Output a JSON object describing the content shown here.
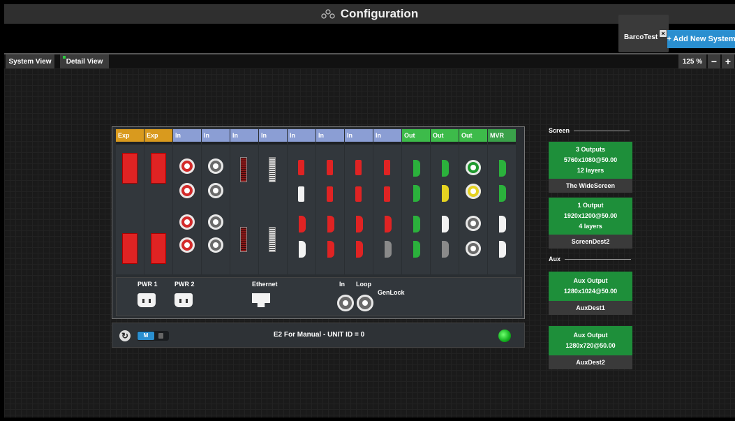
{
  "window": {
    "title": "Configuration",
    "title_icon": "configuration-icon"
  },
  "systems_bar": {
    "system_tab": "BarcoTest",
    "add_system": "+ Add New System"
  },
  "view_tabs": {
    "system_view": "System View",
    "detail_view": "Detail View"
  },
  "zoom": {
    "level": "125 %",
    "minus": "−",
    "plus": "+"
  },
  "device": {
    "slots": [
      {
        "label": "Exp",
        "type": "exp"
      },
      {
        "label": "Exp",
        "type": "exp"
      },
      {
        "label": "In",
        "type": "in"
      },
      {
        "label": "In",
        "type": "in"
      },
      {
        "label": "In",
        "type": "in"
      },
      {
        "label": "In",
        "type": "in"
      },
      {
        "label": "In",
        "type": "in"
      },
      {
        "label": "In",
        "type": "in"
      },
      {
        "label": "In",
        "type": "in"
      },
      {
        "label": "In",
        "type": "in"
      },
      {
        "label": "Out",
        "type": "out"
      },
      {
        "label": "Out",
        "type": "out"
      },
      {
        "label": "Out",
        "type": "out"
      },
      {
        "label": "MVR",
        "type": "mvr"
      }
    ],
    "panel": {
      "pwr1": "PWR 1",
      "pwr2": "PWR 2",
      "ethernet": "Ethernet",
      "in": "In",
      "loop": "Loop",
      "genlock": "GenLock"
    }
  },
  "status": {
    "mode": "M",
    "unit": "E2 For Manual - UNIT ID = 0",
    "led_color": "#22c22e"
  },
  "destinations": {
    "screen_title": "Screen",
    "aux_title": "Aux",
    "screens": [
      {
        "line1": "3 Outputs",
        "line2": "5760x1080@50.00",
        "line3": "12 layers",
        "name": "The WideScreen"
      },
      {
        "line1": "1 Output",
        "line2": "1920x1200@50.00",
        "line3": "4 layers",
        "name": "ScreenDest2"
      }
    ],
    "aux": [
      {
        "line1": "Aux Output",
        "line2": "1280x1024@50.00",
        "name": "AuxDest1"
      },
      {
        "line1": "Aux Output",
        "line2": "1280x720@50.00",
        "name": "AuxDest2"
      }
    ]
  },
  "colors": {
    "accent": "#2a8fd0",
    "exp": "#d99a1e",
    "in": "#8b9ed4",
    "out": "#3dbb4a",
    "dest_green": "#1e8f3a"
  }
}
